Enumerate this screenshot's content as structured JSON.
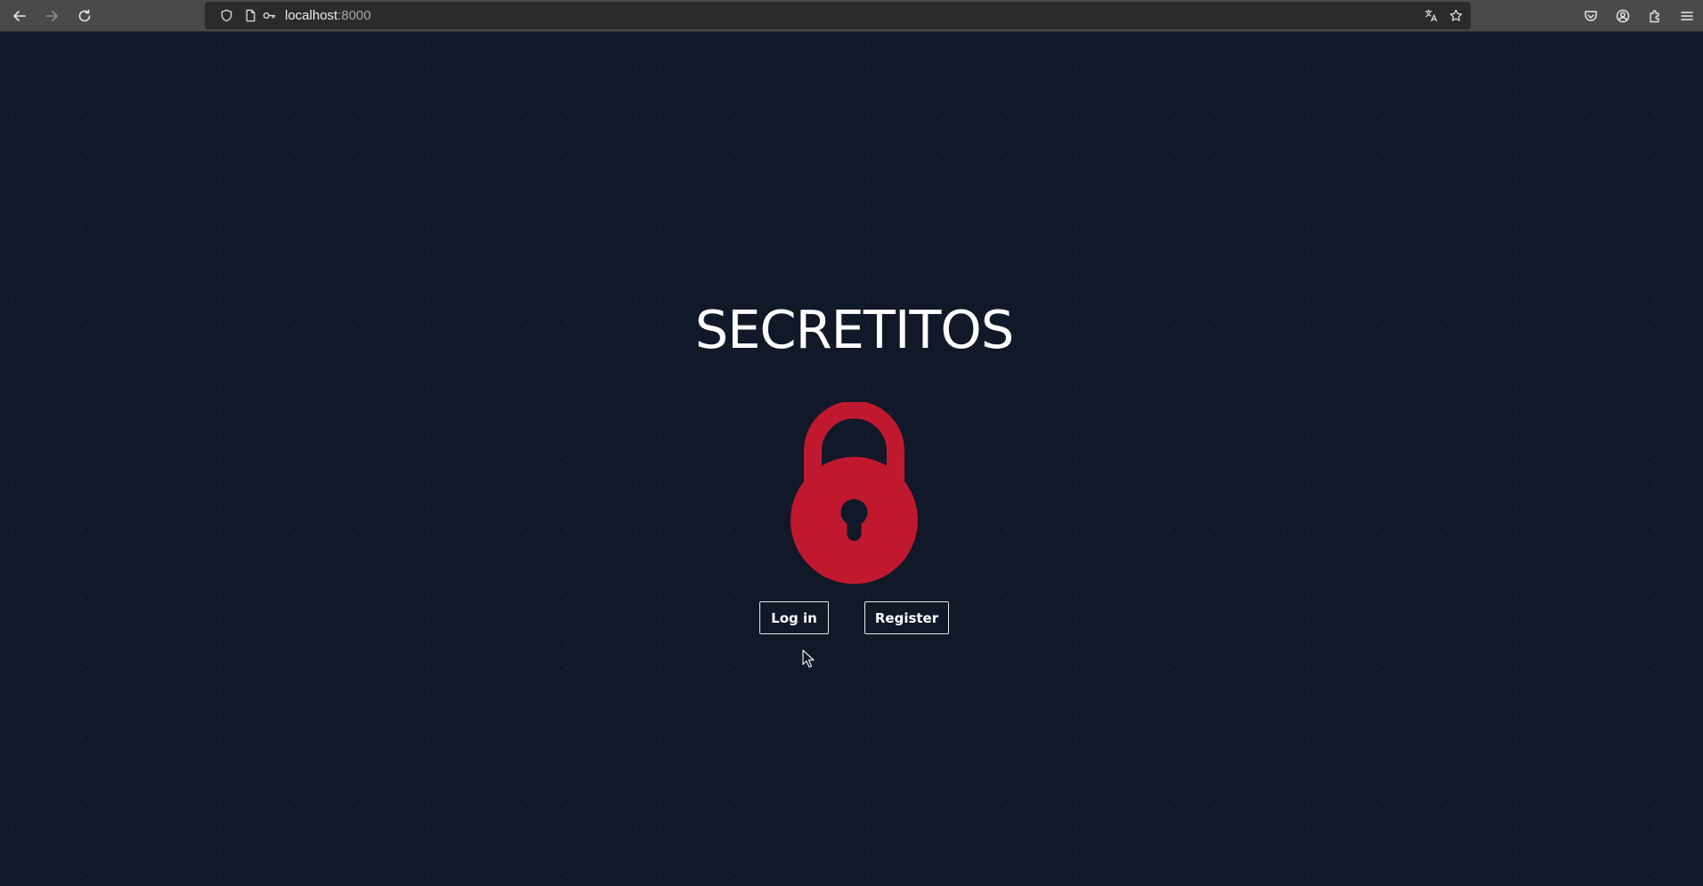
{
  "browser": {
    "url_host": "localhost",
    "url_port": ":8000",
    "icons": {
      "back": "back-arrow-icon",
      "forward": "forward-arrow-icon",
      "reload": "reload-icon",
      "shield": "shield-icon",
      "page": "page-icon",
      "key": "key-icon",
      "translate": "translate-icon",
      "bookmark": "star-icon",
      "pocket": "pocket-icon",
      "account": "account-icon",
      "extensions": "extensions-icon",
      "menu": "hamburger-menu-icon"
    }
  },
  "page": {
    "title": "SECRETITOS",
    "logo_icon": "padlock-icon",
    "login_label": "Log in",
    "register_label": "Register"
  },
  "colors": {
    "background": "#111827",
    "accent": "#c0192f",
    "text": "#ffffff"
  }
}
